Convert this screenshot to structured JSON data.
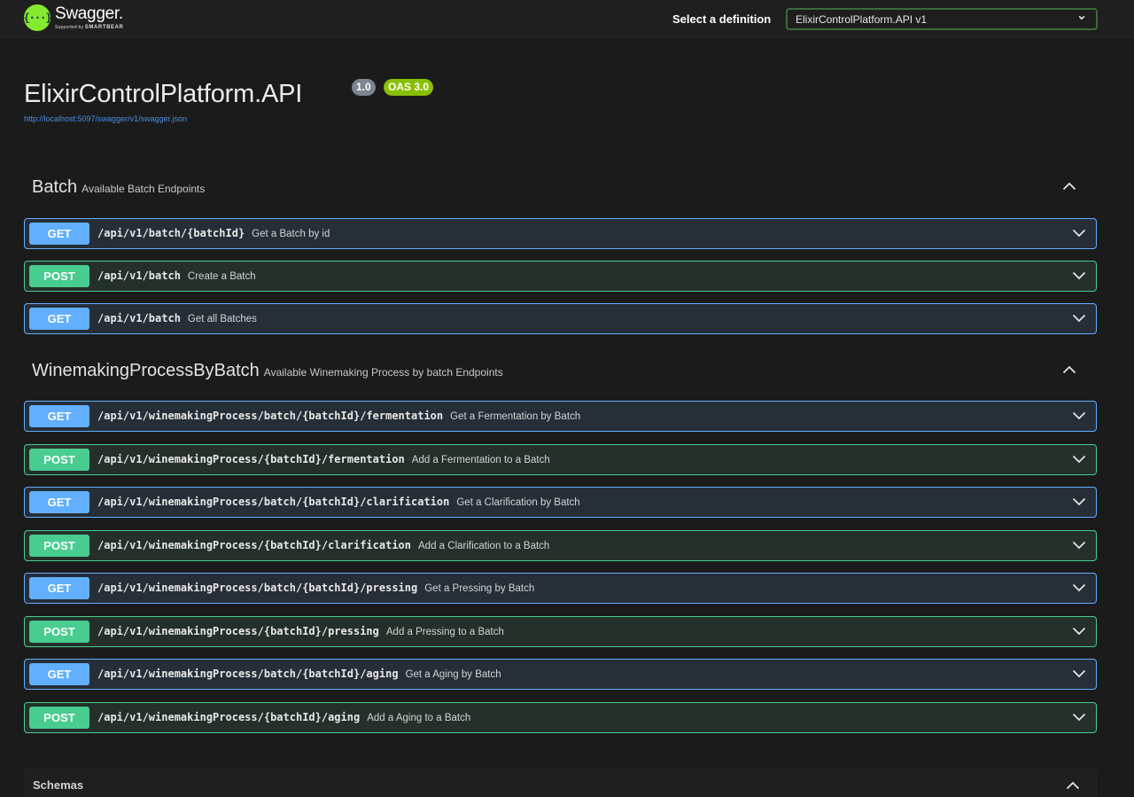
{
  "topbar": {
    "logo_title": "Swagger.",
    "logo_sub_prefix": "Supported by",
    "logo_sub_brand": "SMARTBEAR",
    "definition_label": "Select a definition",
    "definition_value": "ElixirControlPlatform.API v1"
  },
  "info": {
    "title": "ElixirControlPlatform.API",
    "version": "1.0",
    "oas": "OAS 3.0",
    "spec_url": "http://localhost:5097/swagger/v1/swagger.json"
  },
  "tags": [
    {
      "name": "Batch",
      "description": "Available Batch Endpoints",
      "operations": [
        {
          "method": "GET",
          "path": "/api/v1/batch/{batchId}",
          "summary": "Get a Batch by id"
        },
        {
          "method": "POST",
          "path": "/api/v1/batch",
          "summary": "Create a Batch"
        },
        {
          "method": "GET",
          "path": "/api/v1/batch",
          "summary": "Get all Batches"
        }
      ]
    },
    {
      "name": "WinemakingProcessByBatch",
      "description": "Available Winemaking Process by batch Endpoints",
      "operations": [
        {
          "method": "GET",
          "path": "/api/v1/winemakingProcess/batch/{batchId}/fermentation",
          "summary": "Get a Fermentation by Batch"
        },
        {
          "method": "POST",
          "path": "/api/v1/winemakingProcess/{batchId}/fermentation",
          "summary": "Add a Fermentation to a Batch"
        },
        {
          "method": "GET",
          "path": "/api/v1/winemakingProcess/batch/{batchId}/clarification",
          "summary": "Get a Clarification by Batch"
        },
        {
          "method": "POST",
          "path": "/api/v1/winemakingProcess/{batchId}/clarification",
          "summary": "Add a Clarification to a Batch"
        },
        {
          "method": "GET",
          "path": "/api/v1/winemakingProcess/batch/{batchId}/pressing",
          "summary": "Get a Pressing by Batch"
        },
        {
          "method": "POST",
          "path": "/api/v1/winemakingProcess/{batchId}/pressing",
          "summary": "Add a Pressing to a Batch"
        },
        {
          "method": "GET",
          "path": "/api/v1/winemakingProcess/batch/{batchId}/aging",
          "summary": "Get a Aging by Batch"
        },
        {
          "method": "POST",
          "path": "/api/v1/winemakingProcess/{batchId}/aging",
          "summary": "Add a Aging to a Batch"
        }
      ]
    }
  ],
  "schemas": {
    "title": "Schemas"
  },
  "colors": {
    "get": "#61affe",
    "post": "#49cc90",
    "swagger_green": "#85ea2d",
    "oas_badge": "#89bf04"
  },
  "icons": {
    "logo": "swagger-logo-icon",
    "select": "chevron-down-icon",
    "tag_toggle": "chevron-up-icon",
    "op_toggle": "chevron-down-icon"
  }
}
